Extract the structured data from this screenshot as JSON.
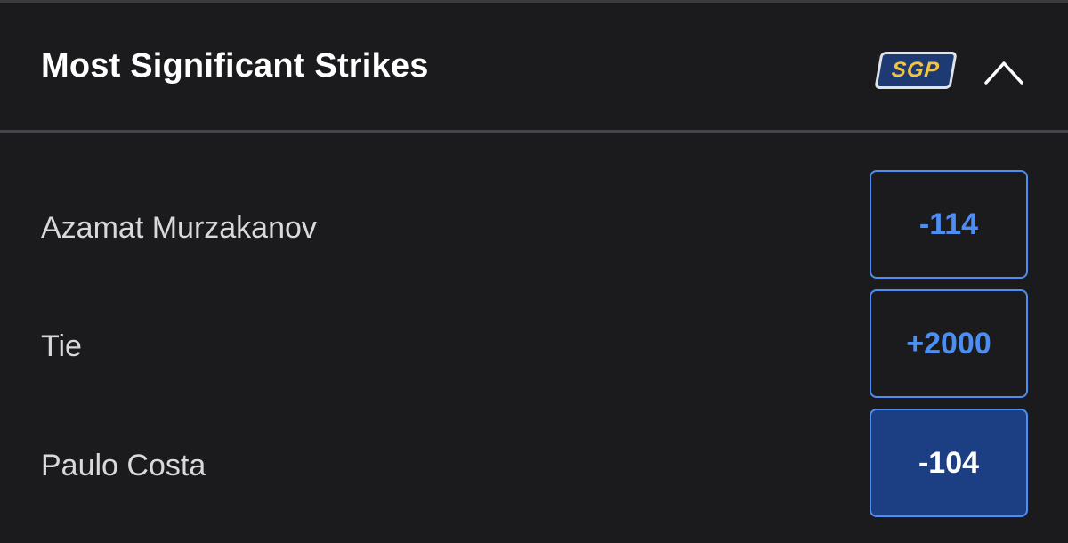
{
  "market": {
    "title": "Most Significant Strikes",
    "badge": "SGP",
    "collapse_icon": "chevron-up-icon"
  },
  "outcomes": [
    {
      "label": "Azamat Murzakanov",
      "odds": "-114",
      "selected": false
    },
    {
      "label": "Tie",
      "odds": "+2000",
      "selected": false
    },
    {
      "label": "Paulo Costa",
      "odds": "-104",
      "selected": true
    }
  ],
  "colors": {
    "background": "#1b1b1d",
    "accent_blue": "#4d8ef5",
    "selected_fill": "#1c3f83",
    "badge_fill": "#1e3a72",
    "badge_text": "#f6c43c"
  }
}
